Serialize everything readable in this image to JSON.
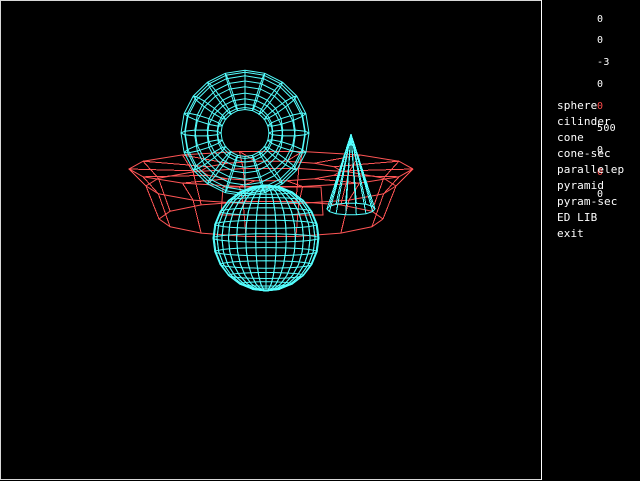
{
  "coords": {
    "rows": [
      {
        "text": "0",
        "color": "#ffffff"
      },
      {
        "text": "0",
        "color": "#ffffff"
      },
      {
        "text": "-3",
        "color": "#ffffff"
      },
      {
        "text": "0",
        "color": "#ffffff"
      },
      {
        "text": "0",
        "color": "#ff4a4a"
      },
      {
        "text": "500",
        "color": "#ffffff"
      },
      {
        "text": "0",
        "color": "#ffffff"
      },
      {
        "text": "0",
        "color": "#ff4a4a"
      },
      {
        "text": "0",
        "color": "#ffffff"
      }
    ]
  },
  "menu": {
    "items": [
      {
        "label": "sphere"
      },
      {
        "label": "cilinder"
      },
      {
        "label": "cone"
      },
      {
        "label": "cone-sec"
      },
      {
        "label": "parallelep"
      },
      {
        "label": "pyramid"
      },
      {
        "label": "pyram-sec"
      },
      {
        "label": "ED LIB"
      },
      {
        "label": "exit"
      }
    ]
  },
  "colors": {
    "background": "#000000",
    "cyan_wireframe": "#55ffff",
    "red_wireframe": "#ff5555",
    "text": "#ffffff",
    "highlight": "#ff4a4a"
  }
}
